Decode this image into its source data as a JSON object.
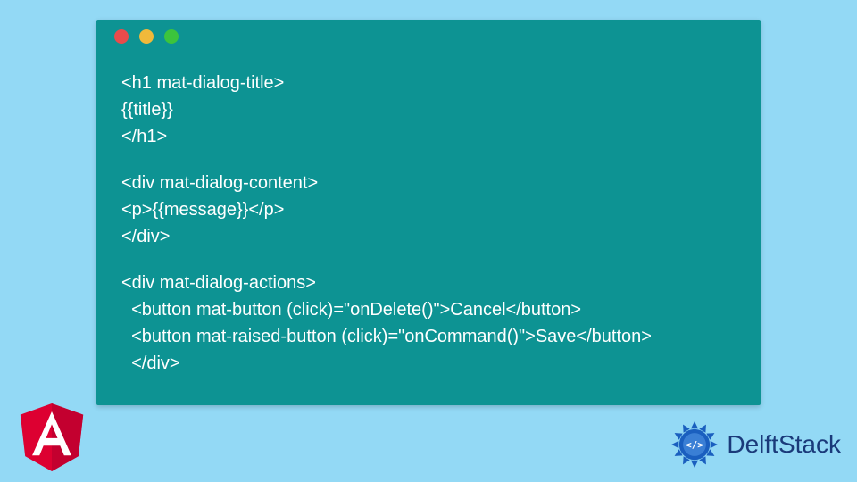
{
  "code": {
    "block1": "<h1 mat-dialog-title>\n{{title}}\n</h1>",
    "block2": "<div mat-dialog-content>\n<p>{{message}}</p>\n</div>",
    "block3": "<div mat-dialog-actions>\n  <button mat-button (click)=\"onDelete()\">Cancel</button>\n  <button mat-raised-button (click)=\"onCommand()\">Save</button>\n  </div>"
  },
  "branding": {
    "delftstack_label": "DelftStack"
  },
  "colors": {
    "page_bg": "#93d9f5",
    "window_bg": "#0d9393",
    "code_text": "#ffffff",
    "dot_red": "#e94b4b",
    "dot_yellow": "#f0b93a",
    "dot_green": "#3cc43c",
    "angular_red": "#dd0031",
    "delft_blue": "#1a3a7a"
  }
}
